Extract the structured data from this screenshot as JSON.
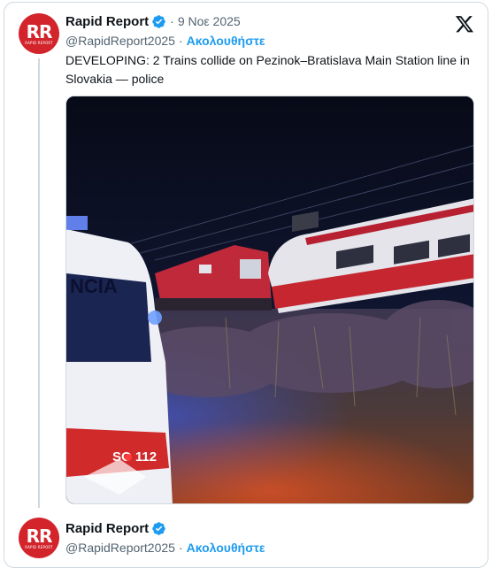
{
  "tweets": [
    {
      "author": {
        "avatar_text": "RR",
        "avatar_subtext": "RAPID REPORT",
        "name": "Rapid Report",
        "handle": "@RapidReport2025",
        "follow_label": "Ακολουθήστε",
        "verified": true
      },
      "date_separator": "·",
      "date": "9 Νοε 2025",
      "handle_separator": "·",
      "text": "DEVELOPING: 2 Trains collide on Pezinok–Bratislava Main Station line in Slovakia — police",
      "media": {
        "vehicle_text": "NCIA",
        "plate_text": "SO 112"
      }
    },
    {
      "author": {
        "avatar_text": "RR",
        "avatar_subtext": "RAPID REPORT",
        "name": "Rapid Report",
        "handle": "@RapidReport2025",
        "follow_label": "Ακολουθήστε",
        "verified": true
      },
      "handle_separator": "·"
    }
  ],
  "colors": {
    "brand_red": "#d3242c",
    "link_blue": "#1d9bf0",
    "verified_blue": "#1d9bf0",
    "secondary_text": "#536471"
  },
  "icons": [
    "verified-badge-icon",
    "x-logo-icon"
  ]
}
